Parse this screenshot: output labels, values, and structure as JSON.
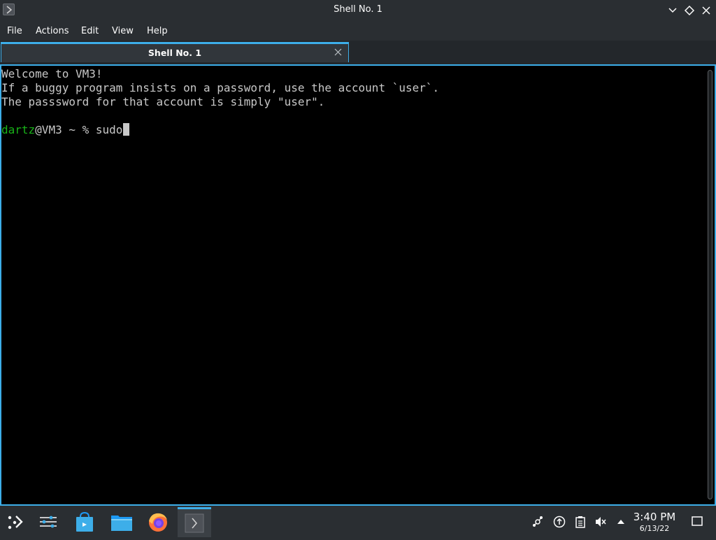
{
  "window": {
    "title": "Shell No. 1"
  },
  "menu": [
    {
      "label": "File"
    },
    {
      "label": "Actions"
    },
    {
      "label": "Edit"
    },
    {
      "label": "View"
    },
    {
      "label": "Help"
    }
  ],
  "tabs": [
    {
      "label": "Shell No. 1",
      "active": true
    }
  ],
  "terminal": {
    "lines": [
      "Welcome to VM3!",
      "If a buggy program insists on a password, use the account `user`.",
      "The passsword for that account is simply \"user\".",
      ""
    ],
    "prompt": {
      "user": "dartz",
      "host_path": "@VM3 ~ % ",
      "command": "sudo"
    }
  },
  "taskbar": {
    "apps": [
      {
        "icon": "application-launcher-icon"
      },
      {
        "icon": "system-settings-icon"
      },
      {
        "icon": "discover-store-icon"
      },
      {
        "icon": "file-manager-icon"
      },
      {
        "icon": "firefox-icon"
      },
      {
        "icon": "konsole-icon",
        "active": true
      }
    ],
    "tray": [
      {
        "icon": "kde-connect-icon"
      },
      {
        "icon": "update-notifier-icon"
      },
      {
        "icon": "clipboard-icon"
      },
      {
        "icon": "volume-muted-icon"
      },
      {
        "icon": "tray-expand-icon"
      }
    ],
    "clock": {
      "time": "3:40 PM",
      "date": "6/13/22"
    }
  },
  "colors": {
    "accent": "#3daee9",
    "prompt_user": "#18b218",
    "terminal_bg": "#000000",
    "terminal_fg": "#c8c8c8"
  }
}
